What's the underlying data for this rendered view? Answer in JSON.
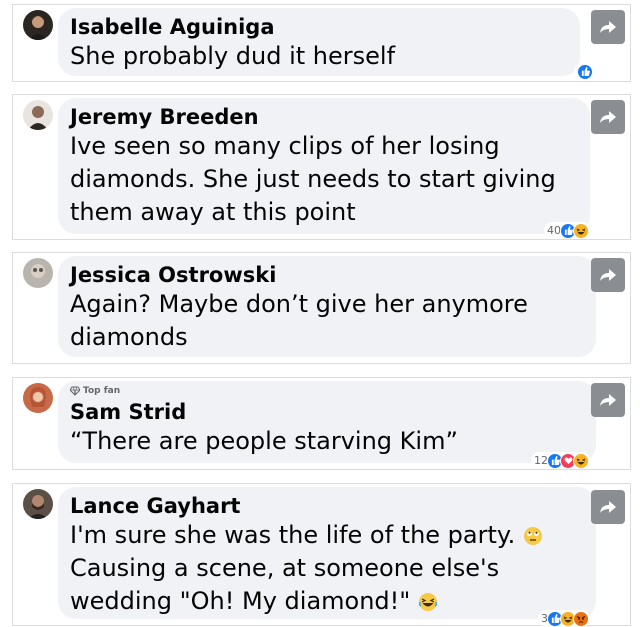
{
  "comments": [
    {
      "name": "Isabelle Aguiniga",
      "text": "She probably dud it herself",
      "reaction_count": ""
    },
    {
      "name": "Jeremy Breeden",
      "text": "Ive seen so many clips of her losing diamonds. She just needs to start giving them away at this point",
      "reaction_count": "40"
    },
    {
      "name": "Jessica Ostrowski",
      "text": "Again? Maybe don’t give her anymore diamonds",
      "reaction_count": ""
    },
    {
      "badge": "Top fan",
      "name": "Sam Strid",
      "text": "“There are people starving Kim”",
      "reaction_count": "12"
    },
    {
      "name": "Lance Gayhart",
      "text_line1": "I'm sure she was the life of the party.",
      "text_line2": "Causing a scene, at someone else's",
      "text_line3": "wedding \"Oh! My diamond!\"",
      "reaction_count": "3"
    }
  ],
  "icons": {
    "share": "share-arrow-icon",
    "like": "like-reaction-icon",
    "love": "love-reaction-icon",
    "haha": "haha-reaction-icon",
    "angry": "angry-reaction-icon",
    "badge": "diamond-icon",
    "eyeroll": "eye-roll-emoji",
    "laugh": "laughing-emoji"
  },
  "colors": {
    "bubble": "#f0f2f5",
    "share_button": "#8a8d91",
    "like": "#1877f2",
    "love": "#f33e58",
    "haha": "#f7b125",
    "angry": "#e9710f"
  }
}
